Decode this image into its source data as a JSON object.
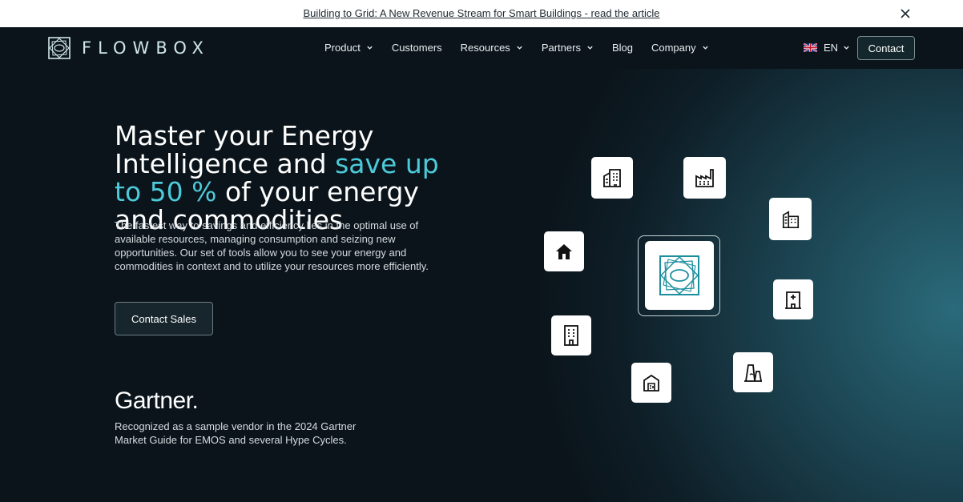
{
  "announcement": {
    "text": "Building to Grid: A New Revenue Stream for Smart Buildings - read the article",
    "close_icon": "close-icon"
  },
  "nav": {
    "logo_text": "FLOWBOX",
    "items": [
      {
        "label": "Product",
        "has_dropdown": true
      },
      {
        "label": "Customers",
        "has_dropdown": false
      },
      {
        "label": "Resources",
        "has_dropdown": true
      },
      {
        "label": "Partners",
        "has_dropdown": true
      },
      {
        "label": "Blog",
        "has_dropdown": false
      },
      {
        "label": "Company",
        "has_dropdown": true
      }
    ],
    "language": "EN",
    "contact_label": "Contact"
  },
  "hero": {
    "headline_part1": "Master your Energy Intelligence and",
    "headline_highlight": "save up to 50 %",
    "headline_part2": "of your energy and commodities",
    "lead": "The fastest way to savings and efficiency lies in the optimal use of available resources, managing consumption and seizing new opportunities. Our set of tools allow you to see your energy and commodities in context and to utilize your resources more efficiently.",
    "cta_label": "Contact Sales",
    "gartner_logo": "Gartner.",
    "gartner_note": "Recognized as a sample vendor in the 2024 Gartner Market Guide for EMOS and several Hype Cycles."
  },
  "colors": {
    "accent": "#4ccad8",
    "background": "#0b141b",
    "teal_glow": "#2a6a7a"
  },
  "icons": [
    "office-building-icon",
    "factory-icon",
    "apartment-building-icon",
    "home-icon",
    "hospital-icon",
    "tower-block-icon",
    "warehouse-icon",
    "power-plant-icon",
    "flowbox-logo-icon"
  ]
}
